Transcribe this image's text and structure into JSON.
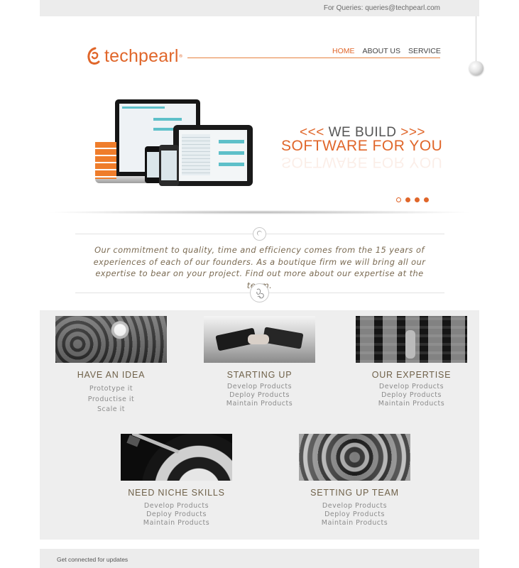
{
  "topbar": {
    "queries": "For Queries: queries@techpearl.com"
  },
  "header": {
    "logo_text": "techpearl",
    "logo_tm": "®",
    "nav": [
      {
        "label": "HOME",
        "active": true
      },
      {
        "label": "ABOUT US",
        "active": false
      },
      {
        "label": "SERVICE",
        "active": false
      }
    ]
  },
  "hero": {
    "arrows_left": "<<<",
    "line1": "WE BUILD",
    "arrows_right": ">>>",
    "line2": "SOFTWARE FOR YOU",
    "slides": 4,
    "active_slide": 1
  },
  "intro": {
    "text": "Our commitment to quality, time and efficiency comes from the 15 years of experiences of each of our founders. As a boutique firm we will bring all our expertise to bear on your project. Find out more about our expertise at the team."
  },
  "services": [
    {
      "title": "HAVE AN IDEA",
      "items": [
        "Prototype it",
        "Productise it",
        "Scale it"
      ]
    },
    {
      "title": "STARTING UP",
      "items": [
        "Develop Products",
        "Deploy Products",
        "Maintain Products"
      ]
    },
    {
      "title": "OUR EXPERTISE",
      "items": [
        "Develop Products",
        "Deploy Products",
        "Maintain Products"
      ]
    },
    {
      "title": "NEED NICHE SKILLS",
      "items": [
        "Develop Products",
        "Deploy Products",
        "Maintain Products"
      ]
    },
    {
      "title": "SETTING UP TEAM",
      "items": [
        "Develop Products",
        "Deploy Products",
        "Maintain Products"
      ]
    }
  ],
  "footer": {
    "text": "Get connected for updates"
  },
  "colors": {
    "accent": "#e0662a",
    "services_bg": "#eeeeee",
    "topbar_bg": "#ececec"
  }
}
